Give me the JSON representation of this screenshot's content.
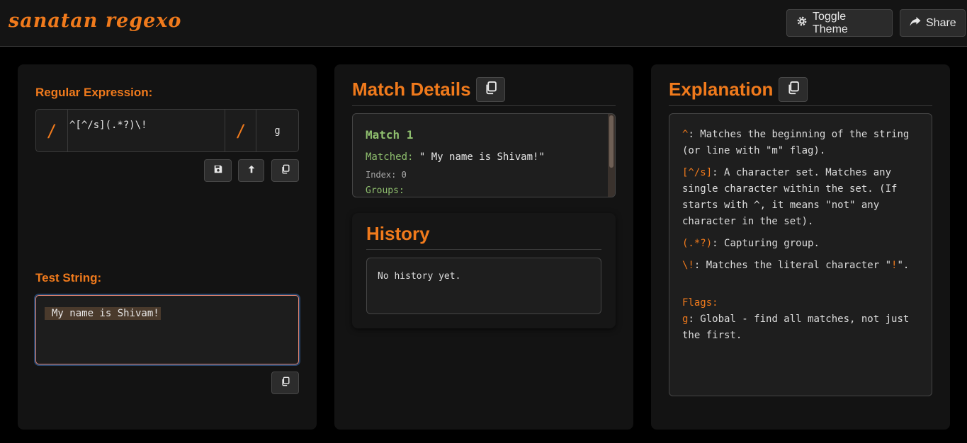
{
  "header": {
    "logo": "sanatan regexo",
    "toggle_theme": "Toggle Theme",
    "share": "Share"
  },
  "regex_panel": {
    "regex_label": "Regular Expression:",
    "open_slash": "/",
    "pattern": "^[^/s](.*?)\\!",
    "close_slash": "/",
    "flags": "g",
    "test_label": "Test String:",
    "test_value": " My name is Shivam!"
  },
  "match_panel": {
    "title": "Match Details",
    "match_title": "Match 1",
    "matched_key": "Matched:",
    "matched_value": " \" My name is Shivam!\"",
    "index": "Index: 0",
    "groups": "Groups:",
    "history_title": "History",
    "history_empty": "No history yet."
  },
  "explanation_panel": {
    "title": "Explanation",
    "items": [
      {
        "token": "^",
        "text": ": Matches the beginning of the string (or line with \"m\" flag)."
      },
      {
        "token": "[^/s]",
        "text": ": A character set. Matches any single character within the set. (If starts with ^, it means \"not\" any character in the set)."
      },
      {
        "token": "(.*?)",
        "text": ": Capturing group."
      },
      {
        "token": "\\!",
        "text": ": Matches the literal character \"",
        "token2": "!",
        "tail": "\"."
      }
    ],
    "flags_heading": "Flags:",
    "flag_token": "g",
    "flag_text": ": Global - find all matches, not just the first."
  },
  "colors": {
    "accent": "#f07a1c",
    "match_green": "#8fbf6e",
    "background": "#000000",
    "panel": "#131313"
  },
  "icons": [
    "gear-icon",
    "share-icon",
    "save-icon",
    "upload-icon",
    "copy-icon"
  ]
}
